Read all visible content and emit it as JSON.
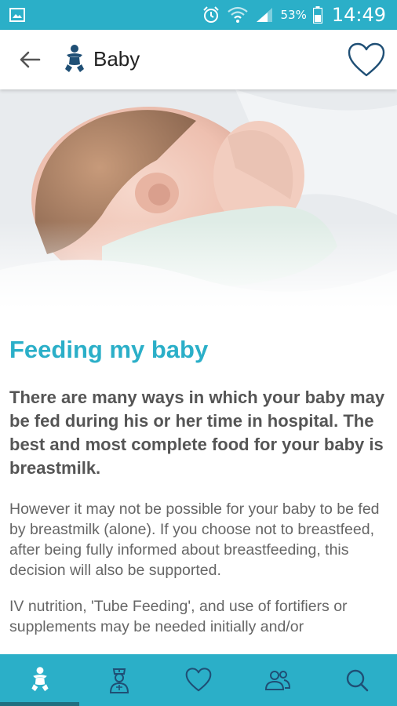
{
  "status_bar": {
    "battery_percent": "53%",
    "time": "14:49"
  },
  "app_bar": {
    "title": "Baby"
  },
  "article": {
    "heading": "Feeding my baby",
    "lead": "There are many ways in which your baby may be fed during his or her time in hospital. The best and most complete food for your baby is breastmilk.",
    "paragraphs": [
      "However it may not be possible for your baby to be fed by breastmilk (alone). If you choose not to breastfeed, after being fully informed about breastfeeding, this decision will also be supported.",
      "IV nutrition, 'Tube Feeding', and use of fortifiers or supplements may be needed initially and/or"
    ]
  },
  "bottom_nav": {
    "items": [
      {
        "name": "baby",
        "icon": "baby-icon",
        "active": true
      },
      {
        "name": "nurse",
        "icon": "nurse-icon",
        "active": false
      },
      {
        "name": "favourites",
        "icon": "heart-icon",
        "active": false
      },
      {
        "name": "people",
        "icon": "people-icon",
        "active": false
      },
      {
        "name": "search",
        "icon": "search-icon",
        "active": false
      }
    ]
  },
  "colors": {
    "accent": "#2bafc8",
    "active_indicator": "#1f6f80",
    "heading_text": "#2bafc8",
    "body_text": "#666666"
  }
}
